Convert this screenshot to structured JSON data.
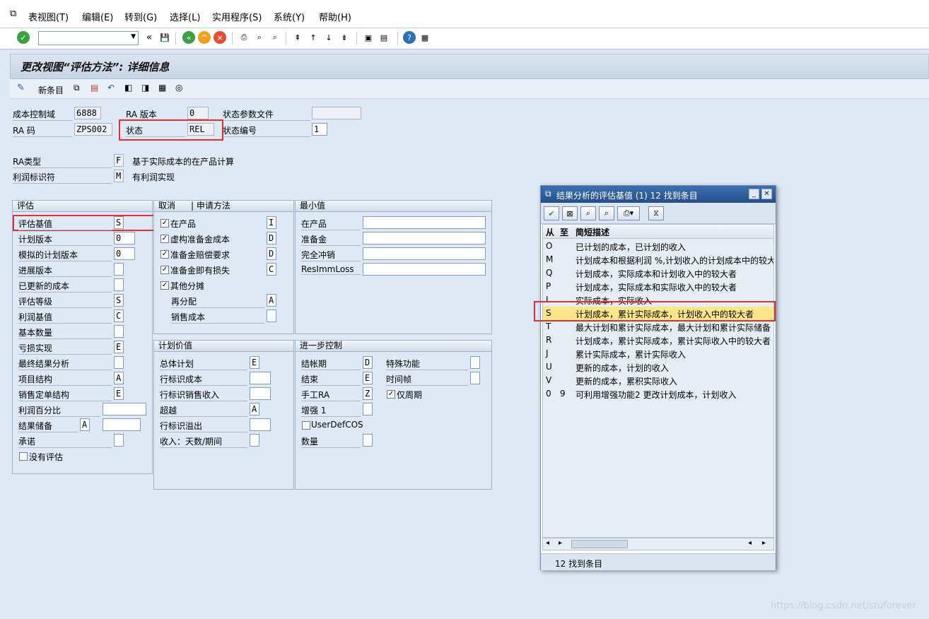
{
  "menu": [
    {
      "label": "表视图(T)"
    },
    {
      "label": "编辑(E)"
    },
    {
      "label": "转到(G)"
    },
    {
      "label": "选择(L)"
    },
    {
      "label": "实用程序(S)"
    },
    {
      "label": "系统(Y)"
    },
    {
      "label": "帮助(H)"
    }
  ],
  "toolbar": {
    "command_value": "",
    "back_label": "«"
  },
  "screen_title": "更改视图“评估方法”: 详细信息",
  "apptoolbar": {
    "new_entries": "新条目"
  },
  "header": {
    "co_area_label": "成本控制域",
    "co_area": "6888",
    "ra_version_label": "RA 版本",
    "ra_version": "0",
    "status_profile_label": "状态参数文件",
    "status_profile": "",
    "ra_key_label": "RA 码",
    "ra_key": "ZPS002",
    "status_label": "状态",
    "status": "REL",
    "status_number_label": "状态编号",
    "status_number": "1",
    "ra_type_label": "RA类型",
    "ra_type": "F",
    "ra_type_text": "基于实际成本的在产品计算",
    "profit_ind_label": "利润标识符",
    "profit_ind": "M",
    "profit_ind_text": "有利润实现"
  },
  "eval": {
    "title": "评估",
    "rows": [
      {
        "label": "评估基值",
        "value": "S"
      },
      {
        "label": "计划版本",
        "value": "0"
      },
      {
        "label": "模拟的计划版本",
        "value": "0"
      },
      {
        "label": "进展版本",
        "value": ""
      },
      {
        "label": "已更新的成本",
        "value": ""
      },
      {
        "label": "评估等级",
        "value": "S"
      },
      {
        "label": "利润基值",
        "value": "C"
      },
      {
        "label": "基本数量",
        "value": ""
      },
      {
        "label": "亏损实现",
        "value": "E"
      },
      {
        "label": "最终结果分析",
        "value": ""
      },
      {
        "label": "项目结构",
        "value": "A"
      },
      {
        "label": "销售定单结构",
        "value": "E"
      }
    ],
    "profit_pct_label": "利润百分比",
    "profit_pct": "",
    "reserve_label": "结果储备",
    "reserve": "A",
    "reserve2": "",
    "commit_label": "承诺",
    "commit": "",
    "no_eval_label": "没有评估"
  },
  "cancel": {
    "title": "取消",
    "method_title": "申请方法",
    "rows": [
      {
        "label": "在产品",
        "checked": true,
        "value": "I"
      },
      {
        "label": "虚构准备金成本",
        "checked": true,
        "value": "D"
      },
      {
        "label": "准备金赔偿要求",
        "checked": true,
        "value": "D"
      },
      {
        "label": "准备金即有损失",
        "checked": true,
        "value": "C"
      },
      {
        "label": "其他分摊",
        "checked": true
      }
    ],
    "realloc_label": "再分配",
    "realloc": "A",
    "cos_label": "销售成本",
    "cos": ""
  },
  "minval": {
    "title": "最小值",
    "rows": [
      {
        "label": "在产品",
        "value": ""
      },
      {
        "label": "准备金",
        "value": ""
      },
      {
        "label": "完全冲销",
        "value": ""
      },
      {
        "label": "ResImmLoss",
        "value": ""
      }
    ]
  },
  "plan": {
    "title": "计划价值",
    "rows": [
      {
        "label": "总体计划",
        "value": "E"
      },
      {
        "label": "行标识成本",
        "value": ""
      },
      {
        "label": "行标识销售收入",
        "value": ""
      },
      {
        "label": "超越",
        "value": "A"
      },
      {
        "label": "行标识溢出",
        "value": ""
      },
      {
        "label": "收入：天数/期间",
        "value": ""
      }
    ]
  },
  "further": {
    "title": "进一步控制",
    "close_label": "结帐期",
    "close": "D",
    "special_label": "特殊功能",
    "special": "",
    "end_label": "结束",
    "end": "E",
    "timeframe_label": "时间帧",
    "timeframe": "",
    "manual_label": "手工RA",
    "manual": "Z",
    "only_period_label": "仅周期",
    "inc_label": "增强 1",
    "inc": "",
    "userdef_label": "UserDefCOS",
    "qty_label": "数量",
    "qty": ""
  },
  "popup": {
    "title": "结果分析的评估基值 (1)   12 找到条目",
    "col_from": "从",
    "col_to": "至",
    "col_desc": "简短描述",
    "rows": [
      {
        "from": "O",
        "to": "",
        "desc": "已计划的成本，已计划的收入"
      },
      {
        "from": "M",
        "to": "",
        "desc": "计划成本和根据利润 %,计划收入的计划成本中的较大"
      },
      {
        "from": "Q",
        "to": "",
        "desc": "计划成本，实际成本和计划收入中的较大者"
      },
      {
        "from": "P",
        "to": "",
        "desc": "计划成本，实际成本和实际收入中的较大者"
      },
      {
        "from": "I",
        "to": "",
        "desc": "实际成本，实际收入"
      },
      {
        "from": "S",
        "to": "",
        "desc": "计划成本，累计实际成本，计划收入中的较大者"
      },
      {
        "from": "T",
        "to": "",
        "desc": "最大计划和累计实际成本，最大计划和累计实际储备"
      },
      {
        "from": "R",
        "to": "",
        "desc": "计划成本，累计实际成本，累计实际收入中的较大者"
      },
      {
        "from": "J",
        "to": "",
        "desc": "累计实际成本，累计实际收入"
      },
      {
        "from": "U",
        "to": "",
        "desc": "更新的成本，计划的收入"
      },
      {
        "from": "V",
        "to": "",
        "desc": "更新的成本，累积实际收入"
      },
      {
        "from": "0",
        "to": "9",
        "desc": "可利用增强功能2 更改计划成本，计划收入"
      }
    ],
    "status": "12 找到条目"
  },
  "watermark": "https://blog.csdn.net/stuforever",
  "colors": {
    "highlight": "#fde68a",
    "red_box": "#e03030"
  }
}
